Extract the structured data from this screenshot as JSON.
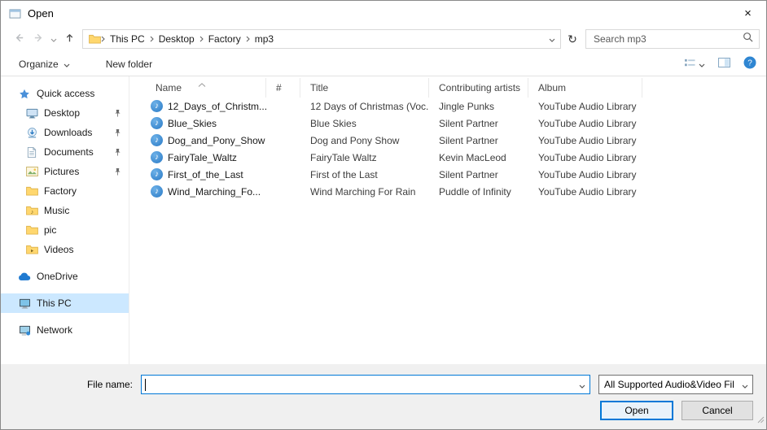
{
  "window": {
    "title": "Open"
  },
  "icons": {
    "close": "×",
    "refresh": "↻",
    "music_file": "♪",
    "help": "?"
  },
  "colors": {
    "accent": "#0078d7",
    "selection": "#cce8ff",
    "folder": "#ffd76e"
  },
  "nav": {
    "breadcrumbs": [
      "This PC",
      "Desktop",
      "Factory",
      "mp3"
    ],
    "search_placeholder": "Search mp3"
  },
  "toolbar": {
    "organize_label": "Organize",
    "new_folder_label": "New folder"
  },
  "sidebar": {
    "items": [
      {
        "label": "Quick access"
      },
      {
        "label": "Desktop",
        "pinned": true
      },
      {
        "label": "Downloads",
        "pinned": true
      },
      {
        "label": "Documents",
        "pinned": true
      },
      {
        "label": "Pictures",
        "pinned": true
      },
      {
        "label": "Factory"
      },
      {
        "label": "Music"
      },
      {
        "label": "pic"
      },
      {
        "label": "Videos"
      },
      {
        "label": "OneDrive"
      },
      {
        "label": "This PC",
        "selected": true
      },
      {
        "label": "Network"
      }
    ]
  },
  "file_list": {
    "columns": {
      "name": "Name",
      "number": "#",
      "title": "Title",
      "artists": "Contributing artists",
      "album": "Album"
    },
    "rows": [
      {
        "name": "12_Days_of_Christm...",
        "title": "12 Days of Christmas (Voc...",
        "artists": "Jingle Punks",
        "album": "YouTube Audio Library"
      },
      {
        "name": "Blue_Skies",
        "title": "Blue Skies",
        "artists": "Silent Partner",
        "album": "YouTube Audio Library"
      },
      {
        "name": "Dog_and_Pony_Show",
        "title": "Dog and Pony Show",
        "artists": "Silent Partner",
        "album": "YouTube Audio Library"
      },
      {
        "name": "FairyTale_Waltz",
        "title": "FairyTale Waltz",
        "artists": "Kevin MacLeod",
        "album": "YouTube Audio Library"
      },
      {
        "name": "First_of_the_Last",
        "title": "First of the Last",
        "artists": "Silent Partner",
        "album": "YouTube Audio Library"
      },
      {
        "name": "Wind_Marching_Fo...",
        "title": "Wind Marching For Rain",
        "artists": "Puddle of Infinity",
        "album": "YouTube Audio Library"
      }
    ]
  },
  "footer": {
    "file_name_label": "File name:",
    "file_name_value": "",
    "file_type_value": "All Supported Audio&Video Fil",
    "open_label": "Open",
    "cancel_label": "Cancel"
  }
}
